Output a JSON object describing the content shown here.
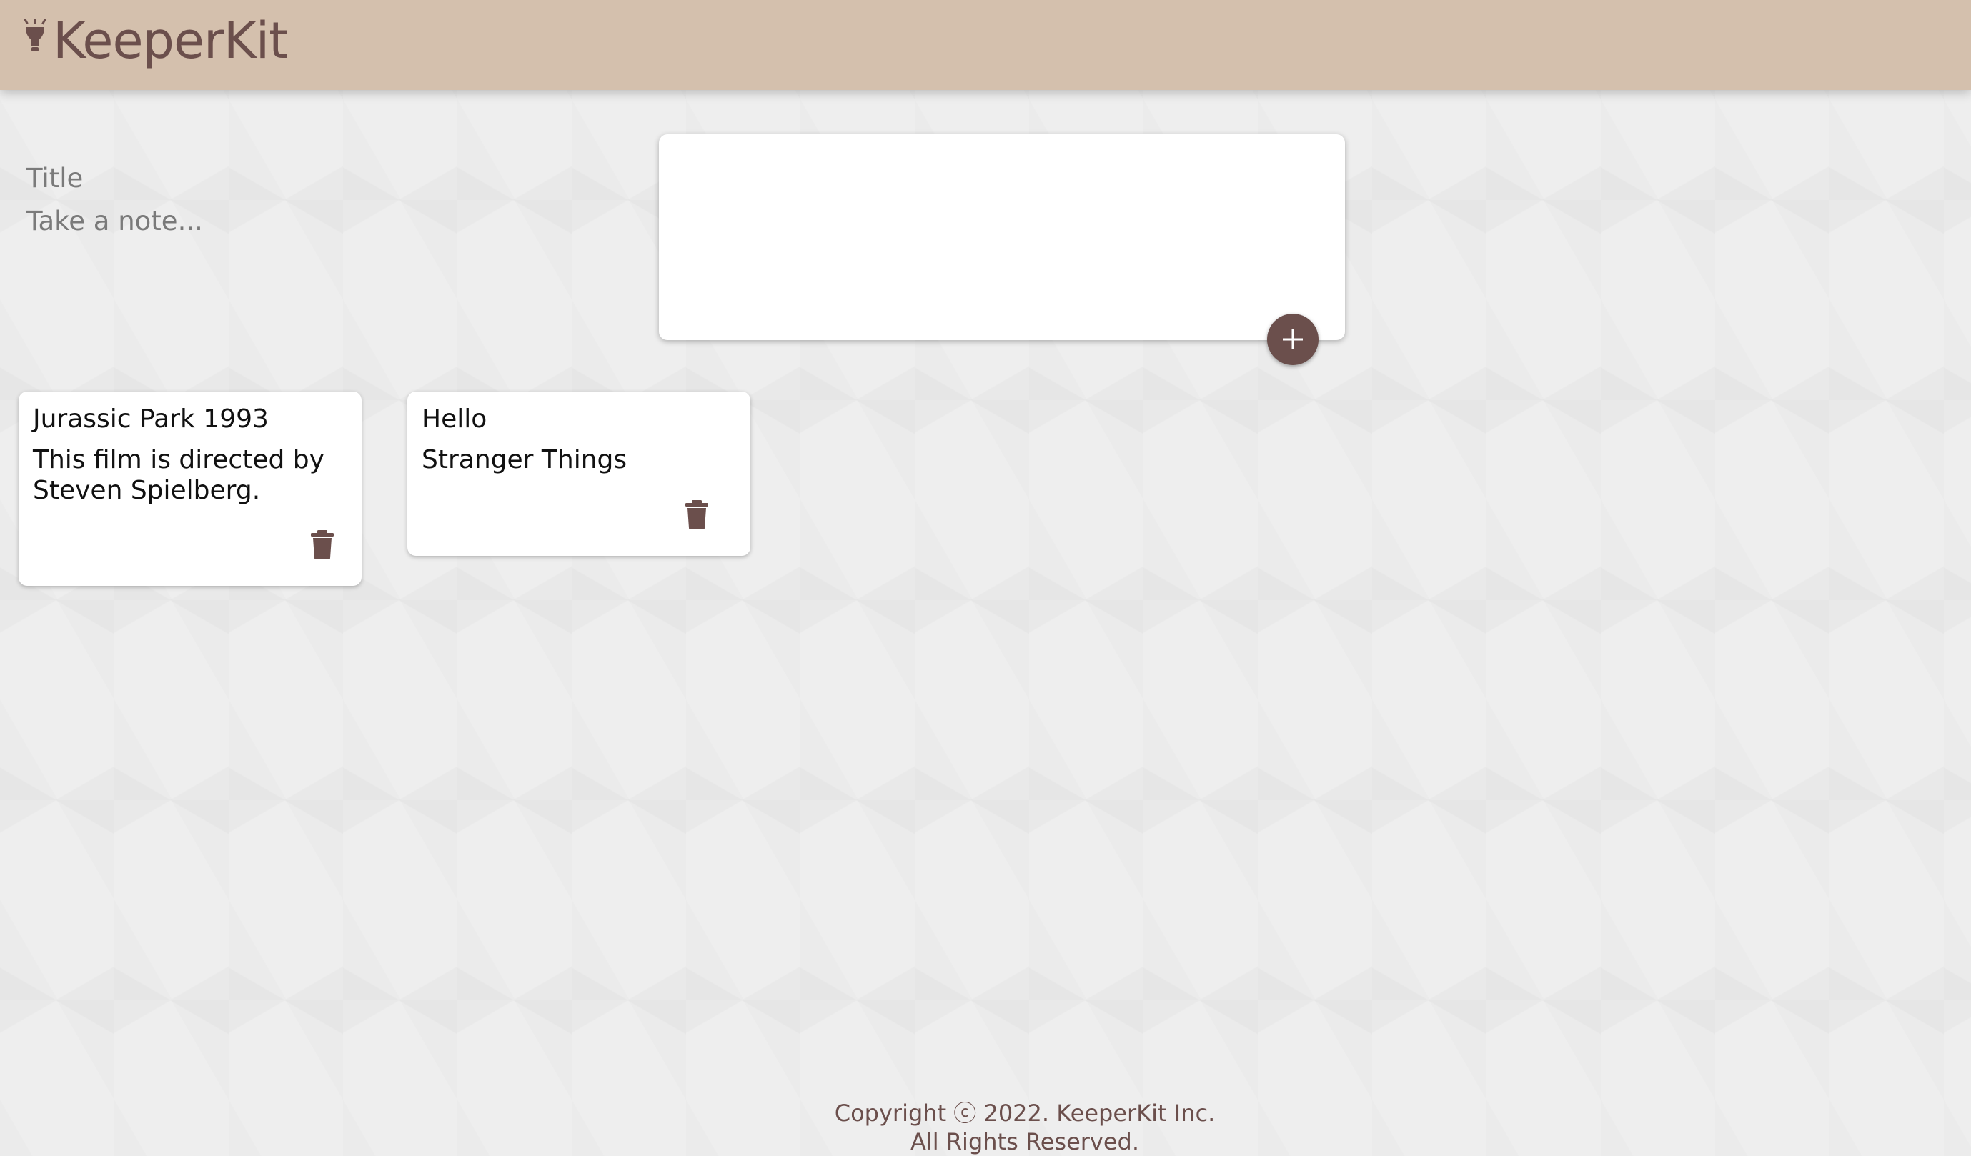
{
  "app": {
    "logo_text": "KeeperKit",
    "logo_icon": "bulb-icon"
  },
  "colors": {
    "header_bg": "#d4c0ad",
    "accent": "#6b4f4c",
    "page_bg": "#eeeeee",
    "card_bg": "#ffffff"
  },
  "create_note": {
    "title_placeholder": "Title",
    "content_placeholder": "Take a note...",
    "add_icon": "plus-icon"
  },
  "notes": [
    {
      "title": "Jurassic Park 1993",
      "content": "This film is directed by Steven Spielberg.",
      "delete_icon": "trash-icon"
    },
    {
      "title": "Hello",
      "content": "Stranger Things",
      "delete_icon": "trash-icon"
    }
  ],
  "footer": {
    "line_1": "Copyright ⓒ 2022. KeeperKit Inc.",
    "line_2": "All Rights Reserved."
  }
}
